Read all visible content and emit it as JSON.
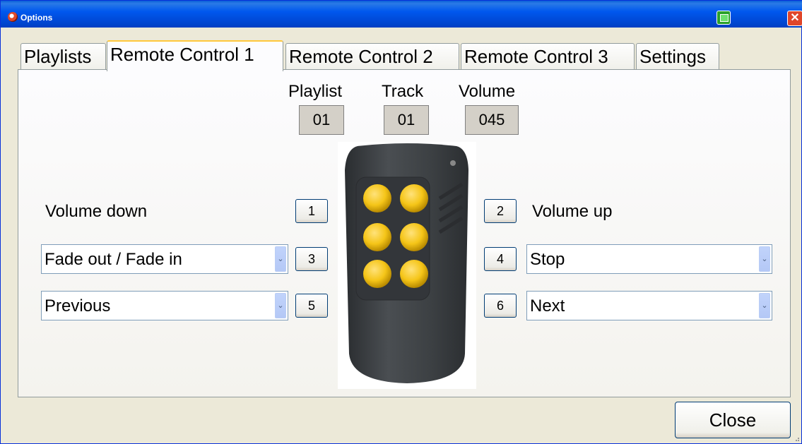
{
  "window": {
    "title": "Options"
  },
  "tabs": [
    {
      "label": "Playlists",
      "active": false
    },
    {
      "label": "Remote Control 1",
      "active": true
    },
    {
      "label": "Remote Control 2",
      "active": false
    },
    {
      "label": "Remote Control 3",
      "active": false
    },
    {
      "label": "Settings",
      "active": false
    }
  ],
  "status": {
    "playlist_label": "Playlist",
    "playlist_value": "01",
    "track_label": "Track",
    "track_value": "01",
    "volume_label": "Volume",
    "volume_value": "045"
  },
  "buttons": {
    "b1": {
      "number": "1",
      "action": "Volume down"
    },
    "b2": {
      "number": "2",
      "action": "Volume up"
    },
    "b3": {
      "number": "3",
      "action": "Fade out / Fade in"
    },
    "b4": {
      "number": "4",
      "action": "Stop"
    },
    "b5": {
      "number": "5",
      "action": "Previous"
    },
    "b6": {
      "number": "6",
      "action": "Next"
    }
  },
  "footer": {
    "close_label": "Close"
  },
  "icons": {
    "app": "app-icon",
    "extra": "printer-icon",
    "close": "close-icon",
    "dropdown": "chevron-down-icon"
  },
  "colors": {
    "titlebar": "#0054e3",
    "active_tab_accent": "#ffc83c",
    "remote_body": "#3c4043",
    "remote_button": "#f5c518"
  }
}
